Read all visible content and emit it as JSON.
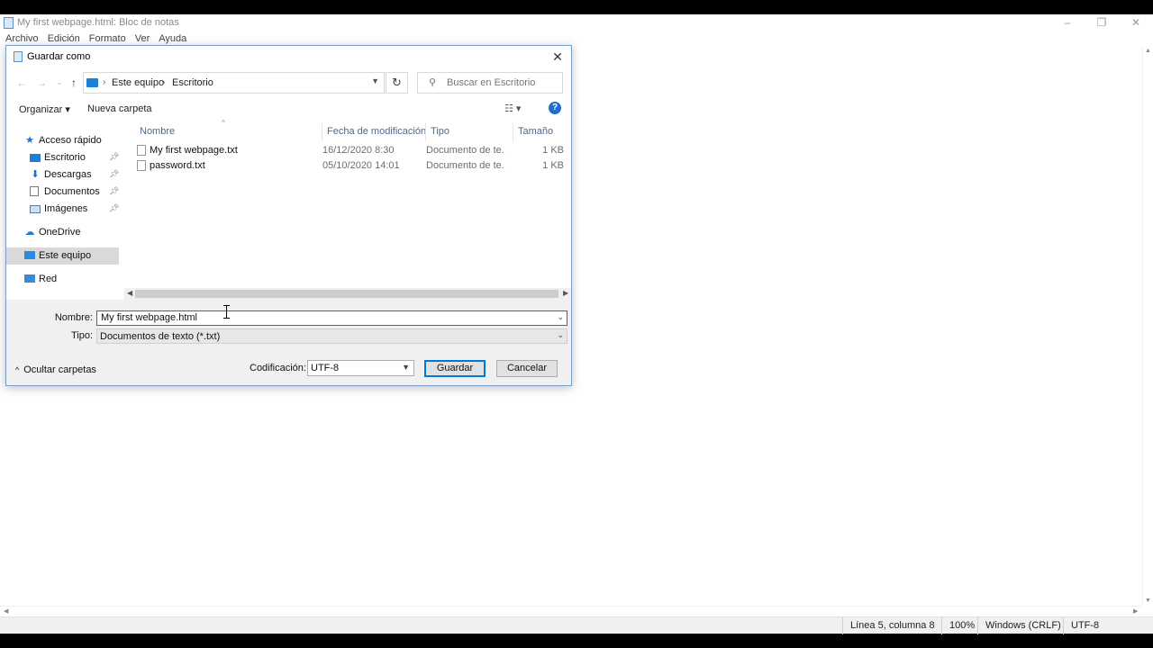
{
  "notepad": {
    "title": "My first webpage.html: Bloc de notas",
    "menu": [
      "Archivo",
      "Edición",
      "Formato",
      "Ver",
      "Ayuda"
    ],
    "window_controls": {
      "minimize": "–",
      "restore": "❐",
      "close": "✕"
    },
    "statusbar": {
      "position": "Línea 5, columna 8",
      "zoom": "100%",
      "line_ending": "Windows (CRLF)",
      "encoding": "UTF-8"
    }
  },
  "dialog": {
    "title": "Guardar como",
    "close_glyph": "✕",
    "address": {
      "crumbs": [
        "Este equipo",
        "Escritorio"
      ],
      "separator": "›"
    },
    "search": {
      "placeholder": "Buscar en Escritorio"
    },
    "toolbar": {
      "organize": "Organizar",
      "organize_caret": "▾",
      "new_folder": "Nueva carpeta",
      "help": "?"
    },
    "navpane": {
      "quick_access": "Acceso rápido",
      "items": [
        {
          "label": "Escritorio",
          "icon": "desktop-icon",
          "pinned": true
        },
        {
          "label": "Descargas",
          "icon": "download-icon",
          "pinned": true
        },
        {
          "label": "Documentos",
          "icon": "documents-icon",
          "pinned": true
        },
        {
          "label": "Imágenes",
          "icon": "pictures-icon",
          "pinned": true
        }
      ],
      "onedrive": "OneDrive",
      "this_pc": "Este equipo",
      "network": "Red"
    },
    "columns": {
      "name": "Nombre",
      "date": "Fecha de modificación",
      "type": "Tipo",
      "size": "Tamaño"
    },
    "files": [
      {
        "name": "My first webpage.txt",
        "date": "16/12/2020 8:30",
        "type": "Documento de te...",
        "size": "1 KB"
      },
      {
        "name": "password.txt",
        "date": "05/10/2020 14:01",
        "type": "Documento de te...",
        "size": "1 KB"
      }
    ],
    "form": {
      "filename_label": "Nombre:",
      "filename_value": "My first webpage.html",
      "filetype_label": "Tipo:",
      "filetype_value": "Documentos de texto (*.txt)",
      "hide_folders": "Ocultar carpetas",
      "encoding_label": "Codificación:",
      "encoding_value": "UTF-8",
      "save": "Guardar",
      "cancel": "Cancelar"
    }
  },
  "colors": {
    "accent": "#0078d7",
    "selected_nav": "#d9d9d9",
    "dialog_bg": "#f0f0f0"
  }
}
